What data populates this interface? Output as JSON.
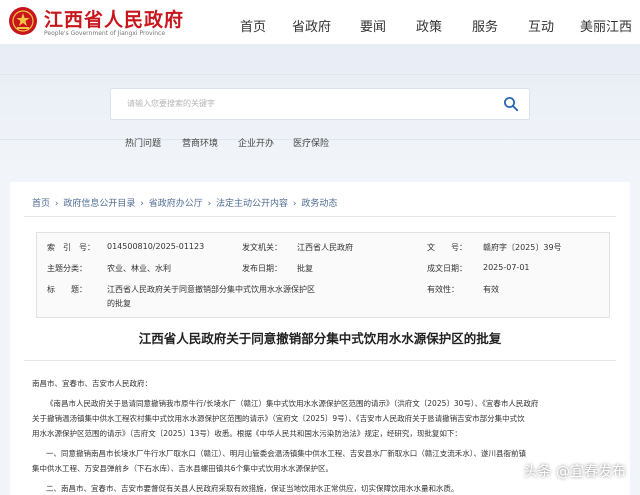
{
  "header": {
    "title": "江西省人民政府",
    "subtitle": "People's Government of Jiangxi Province",
    "nav": [
      "首页",
      "省政府",
      "要闻",
      "政策",
      "服务",
      "互动",
      "美丽江西"
    ]
  },
  "search": {
    "placeholder": "请输入您要搜索的关键字"
  },
  "quick_links": [
    "热门问题",
    "营商环境",
    "企业开办",
    "医疗保险"
  ],
  "breadcrumb": [
    "首页",
    "政府信息公开目录",
    "省政府办公厅",
    "法定主动公开内容",
    "政务动态"
  ],
  "meta": {
    "index_label": "索　引　号：",
    "index_value": "014500810/2025-01123",
    "issuer_label": "发文机关：",
    "issuer_value": "江西省人民政府",
    "docno_label": "文　　号：",
    "docno_value": "赣府字〔2025〕39号",
    "topic_label": "主题分类：",
    "topic_value": "农业、林业、水利",
    "date_label": "发布日期：",
    "date_value": "批复",
    "made_label": "成文日期：",
    "made_value": "2025-07-01",
    "title_label": "标　　题：",
    "title_value_1": "江西省人民政府关于同意撤销部分集中式饮用水水源保护区",
    "title_value_2": "的批复",
    "valid_label": "有效性：",
    "valid_value": "有效"
  },
  "document": {
    "title": "江西省人民政府关于同意撤销部分集中式饮用水水源保护区的批复",
    "recipients": "南昌市、宜春市、吉安市人民政府：",
    "p1_1": "《南昌市人民政府关于恳请同意撤销我市原牛行/长堎水厂（赣江）集中式饮用水水源保护区范围的请示》（洪府文〔2025〕30号）、《宜春市人民政府",
    "p1_2": "关于撤销温汤镇集中供水工程农村集中式饮用水水源保护区范围的请示》（宜府文〔2025〕9号）、《吉安市人民政府关于恳请撤销吉安市部分集中式饮",
    "p1_3": "用水水源保护区范围的请示》（吉府文〔2025〕13号）收悉。根据《中华人民共和国水污染防治法》规定，经研究，现批复如下：",
    "p2_1": "一、同意撤销南昌市长堎水厂牛行水厂取水口（赣江）、明月山管委会温汤镇集中供水工程、吉安县水厂新取水口（赣江支流禾水）、遂川县衙前镇",
    "p2_2": "集中供水工程、万安县弹前乡（下石水库）、吉水县螺田镇共6个集中式饮用水水源保护区。",
    "p3_1": "二、南昌市、宜春市、吉安市要督促有关县人民政府采取有效措施，保证当地饮用水正常供应，切实保障饮用水水量和水质。"
  },
  "watermark": "头条 @宜春发布"
}
